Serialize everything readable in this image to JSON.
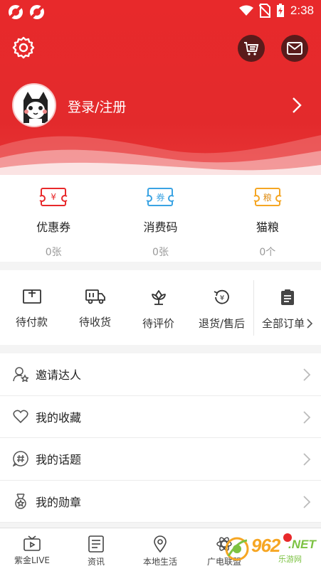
{
  "status_bar": {
    "time": "2:38"
  },
  "header": {
    "login_label": "登录/注册",
    "accent_color": "#e8292b"
  },
  "wallet": [
    {
      "icon": "coupon-icon",
      "icon_text": "¥",
      "label": "优惠券",
      "count": "0张",
      "color": "#e8292b"
    },
    {
      "icon": "voucher-code-icon",
      "icon_text": "券",
      "label": "消费码",
      "count": "0张",
      "color": "#3aa3e3"
    },
    {
      "icon": "cat-food-icon",
      "icon_text": "粮",
      "label": "猫粮",
      "count": "0个",
      "color": "#f5a623"
    }
  ],
  "orders": [
    {
      "icon": "wallet-icon",
      "label": "待付款"
    },
    {
      "icon": "truck-icon",
      "label": "待收货"
    },
    {
      "icon": "flower-icon",
      "label": "待评价"
    },
    {
      "icon": "refund-icon",
      "label": "退货/售后"
    },
    {
      "icon": "clipboard-icon",
      "label": "全部订单"
    }
  ],
  "menu": [
    {
      "icon": "user-star-icon",
      "label": "邀请达人"
    },
    {
      "icon": "heart-icon",
      "label": "我的收藏"
    },
    {
      "icon": "hashtag-icon",
      "label": "我的话题"
    },
    {
      "icon": "medal-icon",
      "label": "我的勋章"
    }
  ],
  "bottom_nav": [
    {
      "icon": "tv-icon",
      "label": "紫金LIVE"
    },
    {
      "icon": "news-icon",
      "label": "资讯"
    },
    {
      "icon": "location-icon",
      "label": "本地生活"
    },
    {
      "icon": "atom-icon",
      "label": "广电联盟"
    }
  ],
  "watermark": {
    "number": "962",
    "suffix": ".NET",
    "text": "乐游网"
  }
}
